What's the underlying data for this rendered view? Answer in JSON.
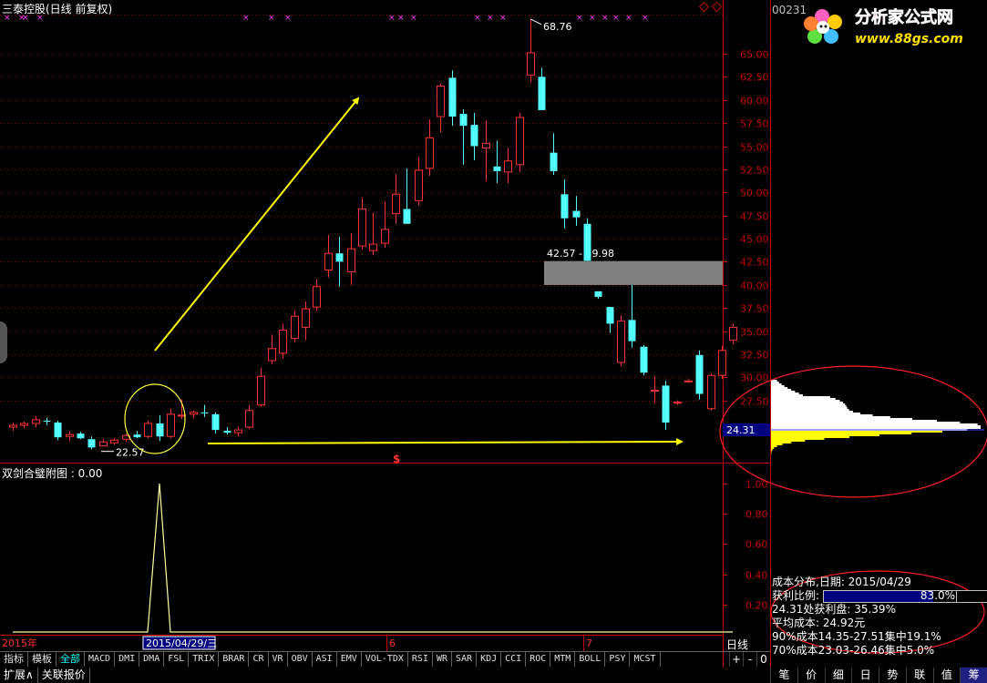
{
  "window": {
    "title": "三泰控股(日线 前复权)",
    "stock_code": "00231",
    "logo_text": "分析家公式网",
    "logo_url": "www.88gs.com"
  },
  "colors": {
    "up": "#ff3232",
    "down": "#54ffff",
    "grid": "#800000",
    "axis": "#c00000",
    "arrow": "#ffff00",
    "annotation_circle": "#ffff40",
    "cost_circle": "#ff2020",
    "cost_high": "#ffffff",
    "cost_low": "#ffff00",
    "signal_line": "#ffffa0",
    "price_box": "#808080",
    "marker_magenta": "#ff40ff"
  },
  "chart_data": [
    {
      "type": "candlestick",
      "ylim": [
        18.5,
        69.5
      ],
      "y_ticks": [
        "65.00",
        "62.50",
        "60.00",
        "57.50",
        "55.00",
        "52.50",
        "50.00",
        "47.50",
        "45.00",
        "42.50",
        "40.00",
        "37.50",
        "35.00",
        "32.50",
        "30.00",
        "27.50"
      ],
      "current_price_label": "24.31",
      "high_label": "68.76",
      "low_label": "22.57",
      "range_label": "42.57 - 39.98",
      "range_box": [
        39.98,
        42.57
      ],
      "x_labels": [
        "2015年",
        "2015/04/29/三",
        "6",
        "7"
      ],
      "candles": [
        {
          "o": 24.6,
          "h": 25.1,
          "l": 24.2,
          "c": 24.8
        },
        {
          "o": 24.8,
          "h": 25.2,
          "l": 24.5,
          "c": 25.0
        },
        {
          "o": 25.0,
          "h": 25.8,
          "l": 24.6,
          "c": 25.4
        },
        {
          "o": 25.3,
          "h": 25.6,
          "l": 24.8,
          "c": 25.2
        },
        {
          "o": 25.1,
          "h": 25.3,
          "l": 23.2,
          "c": 23.5
        },
        {
          "o": 23.6,
          "h": 24.2,
          "l": 23.1,
          "c": 23.8
        },
        {
          "o": 23.9,
          "h": 24.1,
          "l": 23.3,
          "c": 23.4
        },
        {
          "o": 23.3,
          "h": 23.6,
          "l": 22.2,
          "c": 22.4
        },
        {
          "o": 22.57,
          "h": 23.3,
          "l": 22.57,
          "c": 23.0
        },
        {
          "o": 22.9,
          "h": 23.4,
          "l": 22.7,
          "c": 23.2
        },
        {
          "o": 23.3,
          "h": 23.9,
          "l": 23.0,
          "c": 23.7
        },
        {
          "o": 23.8,
          "h": 24.2,
          "l": 23.4,
          "c": 23.5
        },
        {
          "o": 23.6,
          "h": 25.3,
          "l": 23.4,
          "c": 25.0
        },
        {
          "o": 25.0,
          "h": 25.9,
          "l": 23.1,
          "c": 23.6
        },
        {
          "o": 23.6,
          "h": 26.6,
          "l": 23.4,
          "c": 26.0
        },
        {
          "o": 25.9,
          "h": 27.6,
          "l": 25.5,
          "c": 25.9
        },
        {
          "o": 26.0,
          "h": 26.4,
          "l": 25.6,
          "c": 26.2
        },
        {
          "o": 26.2,
          "h": 27.0,
          "l": 25.7,
          "c": 26.1
        },
        {
          "o": 26.0,
          "h": 26.2,
          "l": 23.9,
          "c": 24.3
        },
        {
          "o": 24.2,
          "h": 24.6,
          "l": 23.8,
          "c": 24.0
        },
        {
          "o": 24.0,
          "h": 24.6,
          "l": 23.6,
          "c": 24.3
        },
        {
          "o": 24.6,
          "h": 27.0,
          "l": 24.4,
          "c": 26.4
        },
        {
          "o": 27.0,
          "h": 31.0,
          "l": 26.8,
          "c": 30.1
        },
        {
          "o": 31.8,
          "h": 34.6,
          "l": 31.4,
          "c": 33.1
        },
        {
          "o": 32.6,
          "h": 35.8,
          "l": 32.0,
          "c": 35.1
        },
        {
          "o": 34.2,
          "h": 37.2,
          "l": 33.8,
          "c": 36.6
        },
        {
          "o": 35.4,
          "h": 38.2,
          "l": 34.0,
          "c": 37.4
        },
        {
          "o": 37.6,
          "h": 40.6,
          "l": 37.2,
          "c": 39.8
        },
        {
          "o": 41.6,
          "h": 45.4,
          "l": 40.8,
          "c": 43.4
        },
        {
          "o": 43.4,
          "h": 45.2,
          "l": 39.8,
          "c": 42.5
        },
        {
          "o": 41.4,
          "h": 45.6,
          "l": 40.0,
          "c": 43.9
        },
        {
          "o": 44.2,
          "h": 49.4,
          "l": 43.8,
          "c": 48.2
        },
        {
          "o": 43.7,
          "h": 47.8,
          "l": 43.2,
          "c": 44.4
        },
        {
          "o": 44.5,
          "h": 49.0,
          "l": 44.0,
          "c": 46.0
        },
        {
          "o": 47.7,
          "h": 52.0,
          "l": 46.6,
          "c": 49.8
        },
        {
          "o": 48.2,
          "h": 52.6,
          "l": 46.8,
          "c": 46.6
        },
        {
          "o": 49.1,
          "h": 53.8,
          "l": 48.6,
          "c": 52.4
        },
        {
          "o": 52.6,
          "h": 57.9,
          "l": 51.8,
          "c": 55.9
        },
        {
          "o": 58.2,
          "h": 61.8,
          "l": 56.5,
          "c": 61.5
        },
        {
          "o": 62.4,
          "h": 63.2,
          "l": 57.2,
          "c": 58.2
        },
        {
          "o": 58.5,
          "h": 59.0,
          "l": 53.0,
          "c": 57.2
        },
        {
          "o": 57.3,
          "h": 58.6,
          "l": 53.5,
          "c": 55.0
        },
        {
          "o": 54.8,
          "h": 57.8,
          "l": 51.2,
          "c": 55.3
        },
        {
          "o": 52.8,
          "h": 55.6,
          "l": 51.0,
          "c": 52.3
        },
        {
          "o": 52.2,
          "h": 54.8,
          "l": 51.0,
          "c": 53.4
        },
        {
          "o": 53.0,
          "h": 58.6,
          "l": 52.2,
          "c": 58.1
        },
        {
          "o": 62.7,
          "h": 68.76,
          "l": 61.9,
          "c": 65.1
        },
        {
          "o": 62.5,
          "h": 63.5,
          "l": 58.9,
          "c": 58.9
        },
        {
          "o": 54.3,
          "h": 56.4,
          "l": 51.9,
          "c": 52.3
        },
        {
          "o": 49.8,
          "h": 51.4,
          "l": 46.1,
          "c": 47.2
        },
        {
          "o": 48.0,
          "h": 49.6,
          "l": 46.4,
          "c": 47.3
        },
        {
          "o": 46.6,
          "h": 47.2,
          "l": 42.57,
          "c": 42.6
        },
        {
          "o": 39.3,
          "h": 39.3,
          "l": 38.5,
          "c": 38.7
        },
        {
          "o": 37.6,
          "h": 37.6,
          "l": 34.8,
          "c": 35.8
        },
        {
          "o": 31.6,
          "h": 36.7,
          "l": 31.2,
          "c": 36.1
        },
        {
          "o": 36.2,
          "h": 39.98,
          "l": 33.2,
          "c": 33.9
        },
        {
          "o": 33.3,
          "h": 33.5,
          "l": 30.2,
          "c": 30.5
        },
        {
          "o": 28.6,
          "h": 30.1,
          "l": 27.2,
          "c": 28.6
        },
        {
          "o": 29.1,
          "h": 29.6,
          "l": 24.3,
          "c": 25.1
        },
        {
          "o": 27.2,
          "h": 27.5,
          "l": 27.0,
          "c": 27.3
        },
        {
          "o": 29.6,
          "h": 29.8,
          "l": 29.4,
          "c": 29.6
        },
        {
          "o": 32.4,
          "h": 32.9,
          "l": 27.6,
          "c": 28.2
        },
        {
          "o": 26.6,
          "h": 30.4,
          "l": 26.4,
          "c": 30.2
        },
        {
          "o": 30.2,
          "h": 33.4,
          "l": 29.8,
          "c": 32.9
        },
        {
          "o": 34.0,
          "h": 35.8,
          "l": 33.6,
          "c": 35.4
        }
      ]
    },
    {
      "type": "line",
      "title": "双剑合璧附图 : 0.00",
      "ylim": [
        0,
        1.1
      ],
      "y_ticks": [
        "1.00",
        "0.80",
        "0.60",
        "0.40",
        "0.20"
      ],
      "series": [
        {
          "values": [
            0,
            0,
            0,
            0,
            0,
            0,
            0,
            0,
            0,
            0,
            0,
            0,
            0,
            1,
            0,
            0,
            0,
            0,
            0,
            0,
            0,
            0,
            0,
            0,
            0,
            0,
            0,
            0,
            0,
            0,
            0,
            0,
            0,
            0,
            0,
            0,
            0,
            0,
            0,
            0,
            0,
            0,
            0,
            0,
            0,
            0,
            0,
            0,
            0,
            0,
            0,
            0,
            0,
            0,
            0,
            0,
            0,
            0,
            0,
            0,
            0,
            0,
            0,
            0,
            0
          ]
        }
      ]
    },
    {
      "type": "histogram",
      "title": "成本分布",
      "current_price": 24.31
    }
  ],
  "cost_info": {
    "date_line": "成本分布,日期: 2015/04/29",
    "profit_label": "获利比例:",
    "profit_value": "83.0%",
    "profit_ratio": 0.83,
    "profit_at_price": "24.31处获利盘: 35.39%",
    "avg_cost": "平均成本: 24.92元",
    "conc90": "90%成本14.35-27.51集中19.1%",
    "conc70": "70%成本23.03-26.46集中5.0%"
  },
  "tabs": [
    "指标",
    "模板",
    "全部",
    "MACD",
    "DMI",
    "DMA",
    "FSL",
    "TRIX",
    "BRAR",
    "CR",
    "VR",
    "OBV",
    "ASI",
    "EMV",
    "VOL-TDX",
    "RSI",
    "WR",
    "SAR",
    "KDJ",
    "CCI",
    "ROC",
    "MTM",
    "BOLL",
    "PSY",
    "MCST"
  ],
  "status_buttons": [
    "扩展∧",
    "关联报价"
  ],
  "right_tabs": [
    "笔",
    "价",
    "细",
    "日",
    "势",
    "联",
    "值",
    "筹"
  ],
  "period_label": "日线",
  "nav_buttons": [
    "+",
    "-",
    "0"
  ],
  "dollar_marker": "$"
}
